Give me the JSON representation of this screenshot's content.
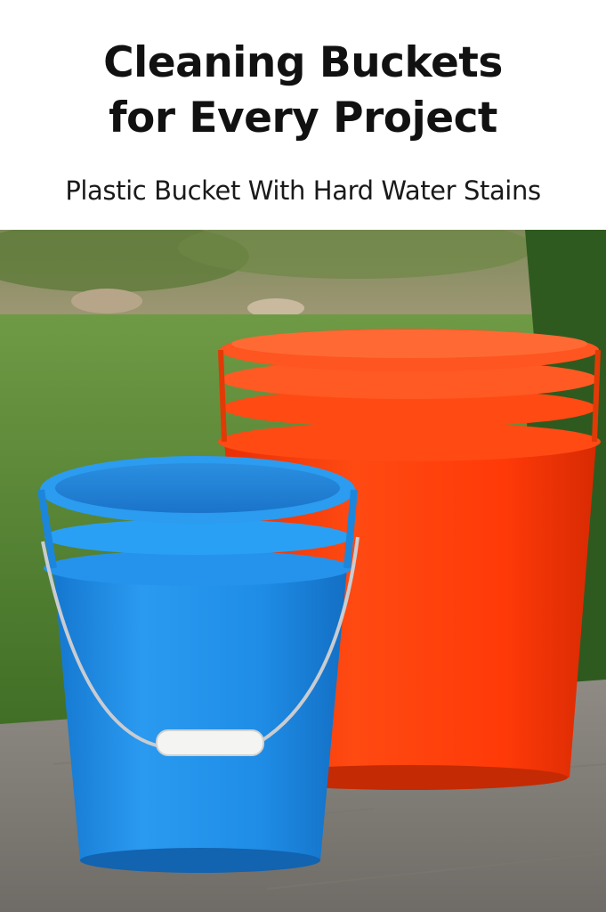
{
  "header": {
    "title_line1": "Cleaning Buckets",
    "title_line2": "for Every Project",
    "subtitle": "Plastic Bucket With Hard Water Stains"
  },
  "photo": {
    "subject": [
      "blue-bucket",
      "orange-bucket"
    ],
    "colors": {
      "blue_bucket": "#1e8fe3",
      "orange_bucket": "#ff3d0a",
      "grass": "#5f8f3a",
      "patio": "#8a8680"
    }
  }
}
